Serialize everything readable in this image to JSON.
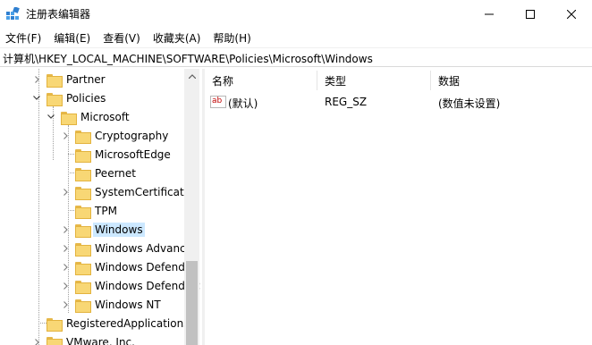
{
  "window": {
    "title": "注册表编辑器",
    "controls": {
      "minimize": "minimize-icon",
      "maximize": "maximize-icon",
      "close": "close-icon"
    }
  },
  "menu": [
    "文件(F)",
    "编辑(E)",
    "查看(V)",
    "收藏夹(A)",
    "帮助(H)"
  ],
  "address": "计算机\\HKEY_LOCAL_MACHINE\\SOFTWARE\\Policies\\Microsoft\\Windows",
  "tree": {
    "items": [
      {
        "label": "Partner",
        "expander": ">",
        "selected": false
      },
      {
        "label": "Policies",
        "expander": "v",
        "selected": false
      },
      {
        "label": "Microsoft",
        "expander": "v",
        "selected": false
      },
      {
        "label": "Cryptography",
        "expander": ">",
        "selected": false
      },
      {
        "label": "MicrosoftEdge",
        "expander": "",
        "selected": false
      },
      {
        "label": "Peernet",
        "expander": "",
        "selected": false
      },
      {
        "label": "SystemCertificates",
        "expander": ">",
        "selected": false
      },
      {
        "label": "TPM",
        "expander": "",
        "selected": false
      },
      {
        "label": "Windows",
        "expander": ">",
        "selected": true
      },
      {
        "label": "Windows Advanced Threat Protection",
        "expander": ">",
        "selected": false
      },
      {
        "label": "Windows Defender",
        "expander": ">",
        "selected": false
      },
      {
        "label": "Windows Defender Security Center",
        "expander": ">",
        "selected": false
      },
      {
        "label": "Windows NT",
        "expander": ">",
        "selected": false
      },
      {
        "label": "RegisteredApplications",
        "expander": "",
        "selected": false
      },
      {
        "label": "VMware, Inc.",
        "expander": ">",
        "selected": false
      }
    ]
  },
  "list": {
    "columns": [
      "名称",
      "类型",
      "数据"
    ],
    "rows": [
      {
        "icon": "ab-string-icon",
        "icon_text": "ab",
        "name": "(默认)",
        "type": "REG_SZ",
        "data": "(数值未设置)"
      }
    ]
  },
  "colors": {
    "selection": "#cce8ff",
    "folder": "#f8d775",
    "scrollbar": "#f0f0f0"
  }
}
